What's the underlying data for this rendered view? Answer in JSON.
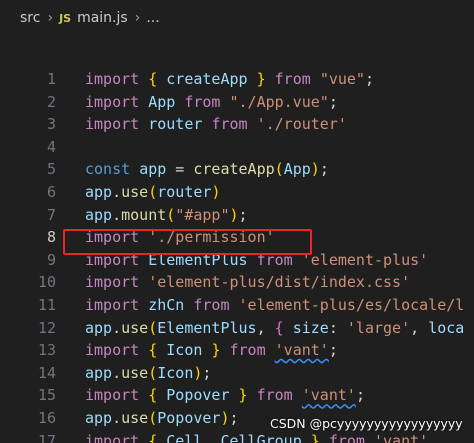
{
  "breadcrumb": {
    "folder": "src",
    "file_badge": "JS",
    "file": "main.js",
    "more": "..."
  },
  "editor": {
    "active_line": 8,
    "lines": [
      {
        "n": "1",
        "tokens": [
          [
            "kw",
            "import"
          ],
          [
            "pn",
            " "
          ],
          [
            "br1",
            "{"
          ],
          [
            "pn",
            " "
          ],
          [
            "id",
            "createApp"
          ],
          [
            "pn",
            " "
          ],
          [
            "br1",
            "}"
          ],
          [
            "pn",
            " "
          ],
          [
            "kw",
            "from"
          ],
          [
            "pn",
            " "
          ],
          [
            "str",
            "\"vue\""
          ],
          [
            "pn",
            ";"
          ]
        ]
      },
      {
        "n": "2",
        "tokens": [
          [
            "kw",
            "import"
          ],
          [
            "pn",
            " "
          ],
          [
            "id",
            "App"
          ],
          [
            "pn",
            " "
          ],
          [
            "kw",
            "from"
          ],
          [
            "pn",
            " "
          ],
          [
            "str",
            "\"./App.vue\""
          ],
          [
            "pn",
            ";"
          ]
        ]
      },
      {
        "n": "3",
        "tokens": [
          [
            "kw",
            "import"
          ],
          [
            "pn",
            " "
          ],
          [
            "id",
            "router"
          ],
          [
            "pn",
            " "
          ],
          [
            "kw",
            "from"
          ],
          [
            "pn",
            " "
          ],
          [
            "str",
            "'./router'"
          ]
        ]
      },
      {
        "n": "4",
        "tokens": []
      },
      {
        "n": "5",
        "tokens": [
          [
            "kb",
            "const"
          ],
          [
            "pn",
            " "
          ],
          [
            "id",
            "app"
          ],
          [
            "pn",
            " = "
          ],
          [
            "fn",
            "createApp"
          ],
          [
            "br1",
            "("
          ],
          [
            "id",
            "App"
          ],
          [
            "br1",
            ")"
          ],
          [
            "pn",
            ";"
          ]
        ]
      },
      {
        "n": "6",
        "tokens": [
          [
            "id",
            "app"
          ],
          [
            "pn",
            "."
          ],
          [
            "fn",
            "use"
          ],
          [
            "br1",
            "("
          ],
          [
            "id",
            "router"
          ],
          [
            "br1",
            ")"
          ]
        ]
      },
      {
        "n": "7",
        "tokens": [
          [
            "id",
            "app"
          ],
          [
            "pn",
            "."
          ],
          [
            "fn",
            "mount"
          ],
          [
            "br1",
            "("
          ],
          [
            "str",
            "\"#app\""
          ],
          [
            "br1",
            ")"
          ],
          [
            "pn",
            ";"
          ]
        ]
      },
      {
        "n": "8",
        "tokens": [
          [
            "kw",
            "import"
          ],
          [
            "pn",
            " "
          ],
          [
            "str",
            "'./permission'"
          ]
        ]
      },
      {
        "n": "9",
        "tokens": [
          [
            "kw",
            "import"
          ],
          [
            "pn",
            " "
          ],
          [
            "id",
            "ElementPlus"
          ],
          [
            "pn",
            " "
          ],
          [
            "kw",
            "from"
          ],
          [
            "pn",
            " "
          ],
          [
            "str",
            "'element-plus'"
          ]
        ]
      },
      {
        "n": "10",
        "tokens": [
          [
            "kw",
            "import"
          ],
          [
            "pn",
            " "
          ],
          [
            "str",
            "'element-plus/dist/index.css'"
          ]
        ]
      },
      {
        "n": "11",
        "tokens": [
          [
            "kw",
            "import"
          ],
          [
            "pn",
            " "
          ],
          [
            "id",
            "zhCn"
          ],
          [
            "pn",
            " "
          ],
          [
            "kw",
            "from"
          ],
          [
            "pn",
            " "
          ],
          [
            "str",
            "'element-plus/es/locale/l"
          ]
        ]
      },
      {
        "n": "12",
        "tokens": [
          [
            "id",
            "app"
          ],
          [
            "pn",
            "."
          ],
          [
            "fn",
            "use"
          ],
          [
            "br1",
            "("
          ],
          [
            "id",
            "ElementPlus"
          ],
          [
            "pn",
            ", "
          ],
          [
            "br2",
            "{"
          ],
          [
            "pn",
            " "
          ],
          [
            "id",
            "size"
          ],
          [
            "pn",
            ": "
          ],
          [
            "str",
            "'large'"
          ],
          [
            "pn",
            ", "
          ],
          [
            "id",
            "loca"
          ]
        ]
      },
      {
        "n": "13",
        "tokens": [
          [
            "kw",
            "import"
          ],
          [
            "pn",
            " "
          ],
          [
            "br1",
            "{"
          ],
          [
            "pn",
            " "
          ],
          [
            "id",
            "Icon"
          ],
          [
            "pn",
            " "
          ],
          [
            "br1",
            "}"
          ],
          [
            "pn",
            " "
          ],
          [
            "kw",
            "from"
          ],
          [
            "pn",
            " "
          ],
          [
            "str squig",
            "'vant'"
          ],
          [
            "pn",
            ";"
          ]
        ]
      },
      {
        "n": "14",
        "tokens": [
          [
            "id",
            "app"
          ],
          [
            "pn",
            "."
          ],
          [
            "fn",
            "use"
          ],
          [
            "br1",
            "("
          ],
          [
            "id",
            "Icon"
          ],
          [
            "br1",
            ")"
          ],
          [
            "pn",
            ";"
          ]
        ]
      },
      {
        "n": "15",
        "tokens": [
          [
            "kw",
            "import"
          ],
          [
            "pn",
            " "
          ],
          [
            "br1",
            "{"
          ],
          [
            "pn",
            " "
          ],
          [
            "id",
            "Popover"
          ],
          [
            "pn",
            " "
          ],
          [
            "br1",
            "}"
          ],
          [
            "pn",
            " "
          ],
          [
            "kw",
            "from"
          ],
          [
            "pn",
            " "
          ],
          [
            "str squig",
            "'vant'"
          ],
          [
            "pn",
            ";"
          ]
        ]
      },
      {
        "n": "16",
        "tokens": [
          [
            "id",
            "app"
          ],
          [
            "pn",
            "."
          ],
          [
            "fn",
            "use"
          ],
          [
            "br1",
            "("
          ],
          [
            "id",
            "Popover"
          ],
          [
            "br1",
            ")"
          ],
          [
            "pn",
            ";"
          ]
        ]
      },
      {
        "n": "17",
        "tokens": [
          [
            "kw",
            "import"
          ],
          [
            "pn",
            " "
          ],
          [
            "br1",
            "{"
          ],
          [
            "pn",
            " "
          ],
          [
            "id",
            "Cell"
          ],
          [
            "pn",
            ", "
          ],
          [
            "id",
            "CellGroup"
          ],
          [
            "pn",
            " "
          ],
          [
            "br1",
            "}"
          ],
          [
            "pn",
            " "
          ],
          [
            "kw",
            "from"
          ],
          [
            "pn",
            " "
          ],
          [
            "str",
            "'vant'"
          ]
        ]
      }
    ]
  },
  "watermark": "CSDN @pcyyyyyyyyyyyyyyyyy",
  "colors": {
    "background": "#1f1f1f",
    "highlight_box": "#e8262a",
    "keyword": "#c586c0",
    "string": "#ce9178",
    "identifier": "#9cdcfe",
    "function": "#dcdcaa"
  }
}
